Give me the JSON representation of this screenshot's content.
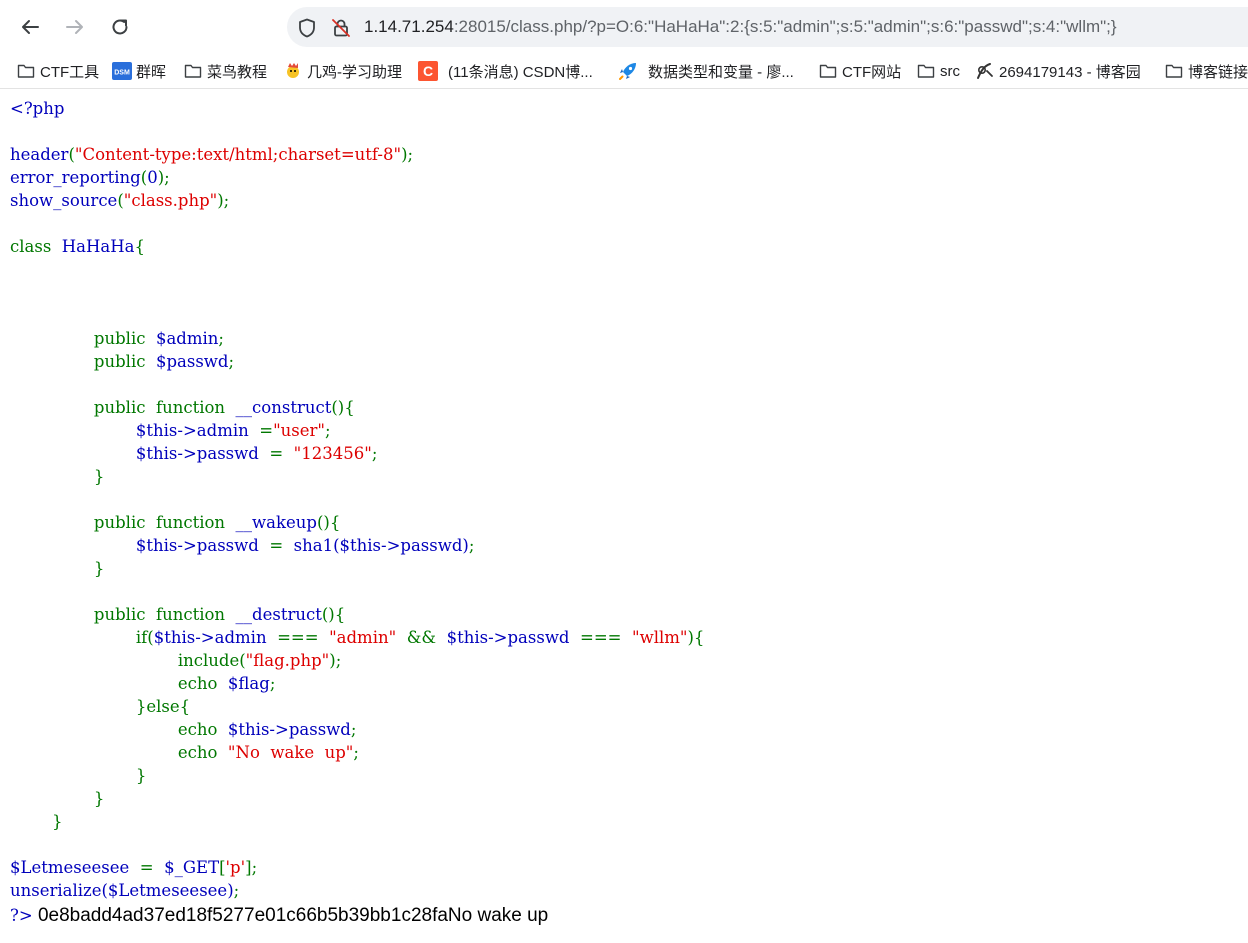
{
  "browser": {
    "url_host": "1.14.71.254",
    "url_rest": ":28015/class.php/?p=O:6:\"HaHaHa\":2:{s:5:\"admin\";s:5:\"admin\";s:6:\"passwd\";s:4:\"wllm\";}",
    "nav_icons": [
      "back-arrow-icon",
      "forward-arrow-icon",
      "reload-icon"
    ],
    "security_icons": [
      "tracking-shield-icon",
      "insecure-lock-icon"
    ]
  },
  "bookmarks": [
    {
      "label": "CTF工具",
      "icon": "folder-icon"
    },
    {
      "label": "群晖",
      "icon": "dsm-icon"
    },
    {
      "label": "菜鸟教程",
      "icon": "folder-icon"
    },
    {
      "label": "几鸡-学习助理",
      "icon": "chick-icon"
    },
    {
      "label": "(11条消息) CSDN博...",
      "icon": "csdn-icon"
    },
    {
      "label": "数据类型和变量 - 廖...",
      "icon": "rocket-icon"
    },
    {
      "label": "CTF网站",
      "icon": "folder-icon"
    },
    {
      "label": "src",
      "icon": "folder-icon"
    },
    {
      "label": "2694179143 - 博客园",
      "icon": "cnblogs-icon"
    },
    {
      "label": "博客链接",
      "icon": "folder-icon"
    }
  ],
  "colors": {
    "html": "#0000bb",
    "keyword": "#007700",
    "string": "#dd0000"
  },
  "source": {
    "open_tag": "<?php",
    "header_fn": "header",
    "header_arg": "\"Content-type:text/html;charset=utf-8\"",
    "error_fn": "error_reporting",
    "error_arg": "0",
    "show_fn": "show_source",
    "show_arg": "\"class.php\"",
    "class_kw": "class",
    "class_name": "HaHaHa",
    "public_kw": "public",
    "function_kw": "function",
    "prop_admin": "$admin",
    "prop_passwd": "$passwd",
    "construct_name": "__construct",
    "this_admin": "$this->admin",
    "this_passwd": "$this->passwd",
    "user_str": "\"user\"",
    "num_str": "\"123456\"",
    "wakeup_name": "__wakeup",
    "sha1_call": "sha1($this->passwd)",
    "destruct_name": "__destruct",
    "if_kw": "if",
    "admin_str": "\"admin\"",
    "wllm_str": "\"wllm\"",
    "include_kw": "include",
    "flag_php_str": "\"flag.php\"",
    "echo_kw": "echo",
    "flag_var": "$flag",
    "else_kw": "else",
    "nowake_str": "\"No  wake  up\"",
    "letme_var": "$Letmeseesee",
    "get_expr": "$_GET",
    "p_str": "'p'",
    "unserialize_call": "unserialize($Letmeseesee)"
  },
  "output": {
    "close_tag": "?>",
    "text": "0e8badd4ad37ed18f5277e01c66b5b39bb1c28faNo wake up"
  }
}
